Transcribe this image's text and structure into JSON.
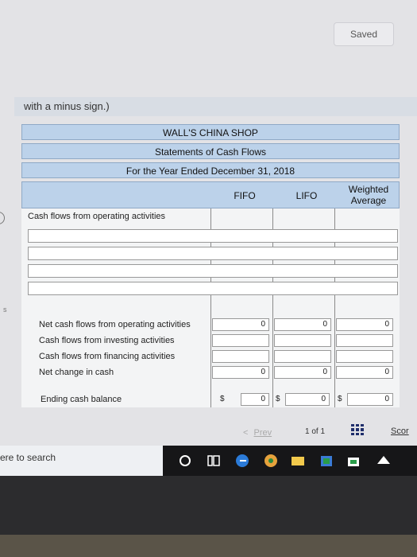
{
  "header": {
    "saved_label": "Saved"
  },
  "instructions": {
    "tail": "with a minus sign.)"
  },
  "stub_text": "s",
  "table": {
    "company": "WALL'S CHINA SHOP",
    "statement": "Statements of Cash Flows",
    "period": "For the Year Ended December 31, 2018",
    "columns": {
      "fifo": "FIFO",
      "lifo": "LIFO",
      "weighted": "Weighted\nAverage"
    },
    "section_label": "Cash flows from operating activities",
    "summary_rows": [
      {
        "label": "Net cash flows from operating activities",
        "fifo": "0",
        "lifo": "0",
        "weighted": "0"
      },
      {
        "label": "Cash flows from investing activities",
        "fifo": "",
        "lifo": "",
        "weighted": ""
      },
      {
        "label": "Cash flows from financing activities",
        "fifo": "",
        "lifo": "",
        "weighted": ""
      },
      {
        "label": "Net change in cash",
        "fifo": "0",
        "lifo": "0",
        "weighted": "0"
      }
    ],
    "ending": {
      "label": "Ending cash balance",
      "currency": "$",
      "fifo": "0",
      "lifo": "0",
      "weighted": "0"
    }
  },
  "pager": {
    "prev_label": "Prev",
    "prev_glyph": "<",
    "count": "1 of 1",
    "score_label": "Scor"
  },
  "taskbar": {
    "search_text": "ere to search"
  },
  "colors": {
    "header_blue": "#bcd2ea",
    "grid_icon": "#1f2e6b"
  }
}
